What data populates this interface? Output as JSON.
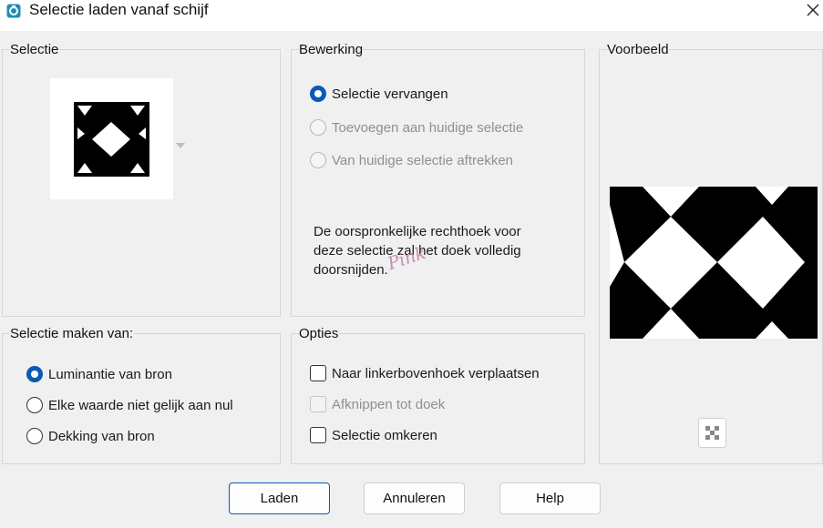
{
  "window": {
    "title": "Selectie laden vanaf schijf"
  },
  "selectie_panel": {
    "title": "Selectie"
  },
  "bewerking": {
    "title": "Bewerking",
    "options": [
      {
        "label": "Selectie vervangen",
        "checked": true,
        "enabled": true
      },
      {
        "label": "Toevoegen aan huidige selectie",
        "checked": false,
        "enabled": false
      },
      {
        "label": "Van huidige selectie aftrekken",
        "checked": false,
        "enabled": false
      }
    ],
    "description": "De oorspronkelijke rechthoek voor deze selectie zal het doek volledig doorsnijden."
  },
  "watermark": {
    "text": "Pink"
  },
  "voorbeeld": {
    "title": "Voorbeeld"
  },
  "maken_van": {
    "title": "Selectie maken van:",
    "options": [
      {
        "label": "Luminantie van bron",
        "checked": true
      },
      {
        "label": "Elke waarde niet gelijk aan nul",
        "checked": false
      },
      {
        "label": "Dekking van bron",
        "checked": false
      }
    ]
  },
  "opties": {
    "title": "Opties",
    "options": [
      {
        "label": "Naar linkerbovenhoek verplaatsen",
        "checked": false,
        "enabled": true
      },
      {
        "label": "Afknippen tot doek",
        "checked": false,
        "enabled": false
      },
      {
        "label": "Selectie omkeren",
        "checked": false,
        "enabled": true
      }
    ]
  },
  "buttons": {
    "load": "Laden",
    "cancel": "Annuleren",
    "help": "Help"
  },
  "colors": {
    "accent": "#0a5ab7",
    "disabled": "#8f8f8f",
    "watermark": "#c17aa6"
  }
}
